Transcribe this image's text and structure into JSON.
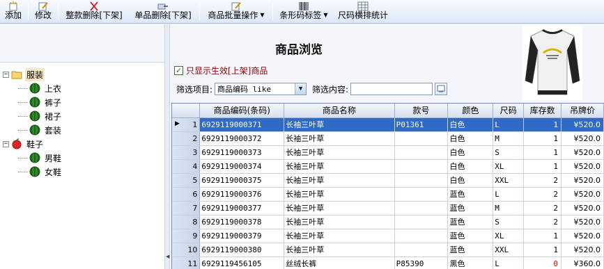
{
  "toolbar": {
    "add": "添加",
    "edit": "修改",
    "delete_all": "整款删除[下架]",
    "delete_single": "单品删除[下架]",
    "batch_ops": "商品批量操作",
    "barcode_label": "条形码标签",
    "size_stats": "尺码横排统计"
  },
  "page_title": "商品浏览",
  "filter": {
    "show_active_label": "只显示生效[上架]商品",
    "show_active_checked": true,
    "field_label": "筛选项目:",
    "field_value": "商品编码 like",
    "content_label": "筛选内容:",
    "content_value": ""
  },
  "tree": [
    {
      "label": "服装",
      "expander": "−",
      "icon": "folder-icon",
      "level": 0,
      "selected": true
    },
    {
      "label": "上衣",
      "icon": "melon-icon",
      "level": 1
    },
    {
      "label": "裤子",
      "icon": "melon-icon",
      "level": 1
    },
    {
      "label": "裙子",
      "icon": "melon-icon",
      "level": 1
    },
    {
      "label": "套装",
      "icon": "melon-icon",
      "level": 1
    },
    {
      "label": "鞋子",
      "expander": "−",
      "icon": "apple-icon",
      "level": 0
    },
    {
      "label": "男鞋",
      "icon": "melon-icon",
      "level": 1
    },
    {
      "label": "女鞋",
      "icon": "melon-icon",
      "level": 1
    }
  ],
  "grid": {
    "columns": [
      "商品编码(条码)",
      "商品名称",
      "款号",
      "颜色",
      "尺码",
      "库存数",
      "吊牌价"
    ],
    "rows": [
      {
        "n": "1",
        "code": "6929119000371",
        "name": "长袖三叶草",
        "style": "P01361",
        "color": "白色",
        "size": "L",
        "stock": "1",
        "price": "¥520.0",
        "selected": true
      },
      {
        "n": "2",
        "code": "6929119000372",
        "name": "长袖三叶草",
        "style": "",
        "color": "白色",
        "size": "M",
        "stock": "1",
        "price": "¥520.0"
      },
      {
        "n": "3",
        "code": "6929119000373",
        "name": "长袖三叶草",
        "style": "",
        "color": "白色",
        "size": "S",
        "stock": "1",
        "price": "¥520.0"
      },
      {
        "n": "4",
        "code": "6929119000374",
        "name": "长袖三叶草",
        "style": "",
        "color": "白色",
        "size": "XL",
        "stock": "1",
        "price": "¥520.0"
      },
      {
        "n": "5",
        "code": "6929119000375",
        "name": "长袖三叶草",
        "style": "",
        "color": "白色",
        "size": "XXL",
        "stock": "2",
        "price": "¥520.0"
      },
      {
        "n": "6",
        "code": "6929119000376",
        "name": "长袖三叶草",
        "style": "",
        "color": "蓝色",
        "size": "L",
        "stock": "2",
        "price": "¥520.0"
      },
      {
        "n": "7",
        "code": "6929119000377",
        "name": "长袖三叶草",
        "style": "",
        "color": "蓝色",
        "size": "M",
        "stock": "2",
        "price": "¥520.0"
      },
      {
        "n": "8",
        "code": "6929119000378",
        "name": "长袖三叶草",
        "style": "",
        "color": "蓝色",
        "size": "S",
        "stock": "2",
        "price": "¥520.0"
      },
      {
        "n": "9",
        "code": "6929119000379",
        "name": "长袖三叶草",
        "style": "",
        "color": "蓝色",
        "size": "XL",
        "stock": "1",
        "price": "¥520.0"
      },
      {
        "n": "10",
        "code": "6929119000380",
        "name": "长袖三叶草",
        "style": "",
        "color": "蓝色",
        "size": "XXL",
        "stock": "1",
        "price": "¥520.0"
      },
      {
        "n": "11",
        "code": "6929119456105",
        "name": "丝绒长裤",
        "style": "P85390",
        "color": "黑色",
        "size": "L",
        "stock": "0",
        "price": "¥360.0",
        "stock_red": true
      }
    ]
  },
  "colors": {
    "selection": "#316ac5",
    "accent_red": "#d40000",
    "checkbox_label": "#8b0000"
  }
}
